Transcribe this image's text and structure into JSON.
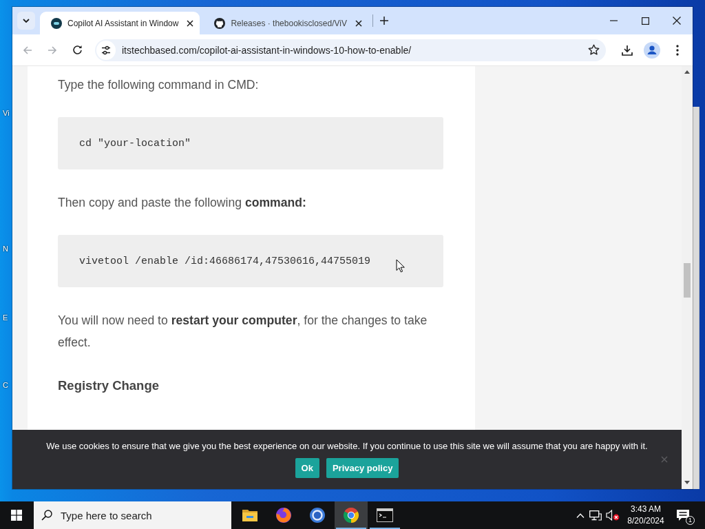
{
  "desktop": {
    "icons": [
      {
        "label": "Vi"
      },
      {
        "label": "N"
      },
      {
        "label": "E"
      },
      {
        "label": "C"
      }
    ]
  },
  "browser": {
    "tabs": [
      {
        "kind": "site",
        "title": "Copilot AI Assistant in Window",
        "selected": true
      },
      {
        "kind": "repository",
        "title": "Releases · thebookisclosed/ViV",
        "selected": false
      }
    ],
    "address": "itstechbased.com/copilot-ai-assistant-in-windows-10-how-to-enable/"
  },
  "article": {
    "blocks": [
      {
        "kind": "paragraph",
        "text": "Type the following command in CMD:"
      },
      {
        "kind": "code",
        "text": "cd \"your-location\""
      },
      {
        "kind": "paragraph",
        "text": "Then copy and paste the following **command:**"
      },
      {
        "kind": "code",
        "text": "vivetool /enable /id:46686174,47530616,44755019"
      },
      {
        "kind": "paragraph",
        "text": "You will now need to **restart your computer**, for the changes to take effect."
      },
      {
        "kind": "heading",
        "text": "Registry Change"
      }
    ]
  },
  "cookie_banner": {
    "message": "We use cookies to ensure that we give you the best experience on our website. If you continue to use this site we will assume that you are happy with it.",
    "buttons": [
      "Ok",
      "Privacy policy"
    ]
  },
  "taskbar": {
    "search_placeholder": "Type here to search",
    "apps": [
      {
        "kind": "folder",
        "selected": false,
        "running": false
      },
      {
        "kind": "fox",
        "selected": false,
        "running": false
      },
      {
        "kind": "ring",
        "selected": false,
        "running": false
      },
      {
        "kind": "wheel",
        "selected": true,
        "running": true
      },
      {
        "kind": "terminal",
        "selected": false,
        "running": true
      }
    ],
    "volume_muted": true,
    "time": "3:43 AM",
    "date": "8/20/2024",
    "notifications": "1"
  }
}
